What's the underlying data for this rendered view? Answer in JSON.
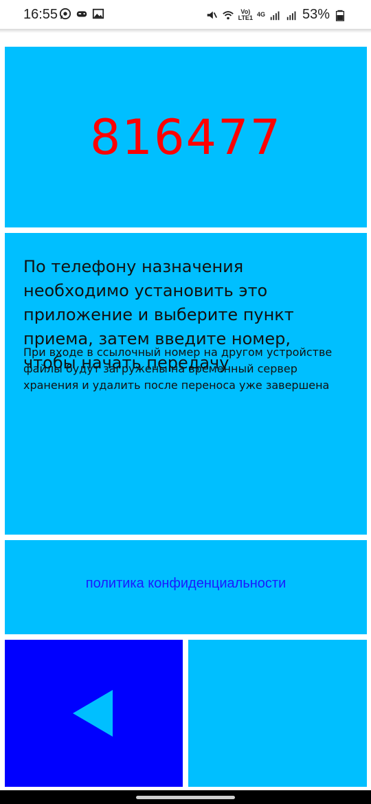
{
  "status_bar": {
    "time": "16:55",
    "network_label_top": "Vo)",
    "network_label_bottom": "LTE1",
    "network_type": "4G",
    "battery": "53%"
  },
  "code_panel": {
    "code": "816477",
    "code_color": "#ff0000",
    "background": "#00bfff"
  },
  "info_panel": {
    "main_text": "По телефону назначения необходимо установить это приложение и выберите пункт приема, затем введите номер, чтобы начать передачу",
    "sub_text": "При входе в ссылочный номер на другом устройстве файлы будут загружены на временный сервер хранения и удалить после переноса уже завершена"
  },
  "policy_panel": {
    "link_text": "политика конфиденциальности",
    "link_color": "#1a1aff"
  },
  "back_button": {
    "icon": "triangle-left-icon",
    "background": "#0000ff"
  },
  "colors": {
    "panel": "#00bfff",
    "accent": "#0000ff"
  }
}
